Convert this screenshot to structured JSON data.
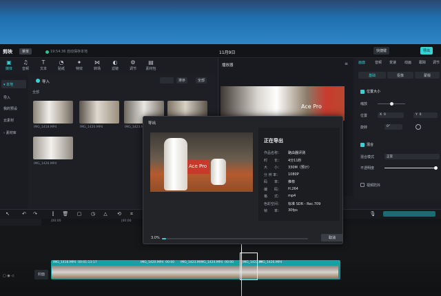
{
  "app": {
    "logo": "剪映",
    "menu_label": "菜单",
    "save_status": "19:54:36 自动保存本地",
    "window_title": "11月9日",
    "right_buttons": [
      "快捷键",
      "导出"
    ]
  },
  "toolbar": {
    "tools": [
      {
        "label": "媒体",
        "icon": "media-icon",
        "glyph": "▣"
      },
      {
        "label": "音频",
        "icon": "audio-icon",
        "glyph": "♫"
      },
      {
        "label": "文本",
        "icon": "text-icon",
        "glyph": "T"
      },
      {
        "label": "贴纸",
        "icon": "sticker-icon",
        "glyph": "◔"
      },
      {
        "label": "特效",
        "icon": "effects-icon",
        "glyph": "✦"
      },
      {
        "label": "转场",
        "icon": "transition-icon",
        "glyph": "⋈"
      },
      {
        "label": "滤镜",
        "icon": "filter-icon",
        "glyph": "◐"
      },
      {
        "label": "调节",
        "icon": "adjust-icon",
        "glyph": "⚙"
      },
      {
        "label": "素材包",
        "icon": "assets-icon",
        "glyph": "▤"
      }
    ]
  },
  "sidebar": {
    "items": [
      {
        "label": "▾ 本地",
        "active": true
      },
      {
        "label": "导入",
        "active": false
      },
      {
        "label": "我的预设",
        "active": false
      },
      {
        "label": "云素材",
        "active": false
      },
      {
        "label": "› 素材库",
        "active": false
      }
    ]
  },
  "media": {
    "import_label": "导入",
    "all_label": "全部",
    "sort_label": "排序",
    "filter_label": "全部",
    "items": [
      "IMG_1418.MP4",
      "IMG_1420.MP4",
      "IMG_1423.MP4",
      "",
      "IMG_1426.MP4"
    ]
  },
  "player": {
    "title": "播放器"
  },
  "inspector": {
    "tabs": [
      "画面",
      "音频",
      "变速",
      "动画",
      "跟踪",
      "调节"
    ],
    "segments": [
      "基础",
      "抠像",
      "蒙版"
    ],
    "position_size_label": "位置大小",
    "scale_label": "缩放",
    "position_label": "位置",
    "position_x": "X",
    "position_y": "Y",
    "position_x_val": "0",
    "position_y_val": "0",
    "rotate_label": "旋转",
    "rotate_val": "0°",
    "blend_label": "混合",
    "blend_mode_label": "混合模式",
    "blend_mode_val": "正常",
    "opacity_label": "不透明度",
    "stabilize_label": "视频防抖"
  },
  "timeline": {
    "ruler_times": [
      "|00:00",
      "|00:00",
      "00:00"
    ],
    "cover_label": "封面",
    "clips": [
      {
        "name": "IMG_1418.MP4",
        "duration": "00:01:13:17"
      },
      {
        "name": "IMG_1420.MP4",
        "duration": "00:00"
      },
      {
        "name": "IMG_1423.M",
        "duration": ""
      },
      {
        "name": "IMG_1424.MP4",
        "duration": "00:00"
      },
      {
        "name": "IMG_1423.M",
        "duration": ""
      },
      {
        "name": "IMG_1426.MP4",
        "duration": ""
      }
    ]
  },
  "export_dialog": {
    "title": "导出",
    "status_heading": "正在导出",
    "fields": [
      {
        "key": "作品名称：",
        "value": "路由器评测"
      },
      {
        "key": "时　　长：",
        "value": "4分11秒"
      },
      {
        "key": "大　　小：",
        "value": "330M（预计）"
      },
      {
        "key": "分 辨 率：",
        "value": "1080P"
      },
      {
        "key": "码　　率：",
        "value": "推荐"
      },
      {
        "key": "编　　码：",
        "value": "H.264"
      },
      {
        "key": "格　　式：",
        "value": "mp4"
      },
      {
        "key": "色彩空间：",
        "value": "标准 SDR - Rec.709"
      },
      {
        "key": "帧　　率：",
        "value": "30fps"
      }
    ],
    "progress_text": "3.0%",
    "progress": 0.03,
    "cancel_label": "取消",
    "preview_overlay": "Ace Pro"
  },
  "colors": {
    "accent": "#38d1d6",
    "track": "#1aa5a8",
    "dialog_bg": "#222428"
  }
}
